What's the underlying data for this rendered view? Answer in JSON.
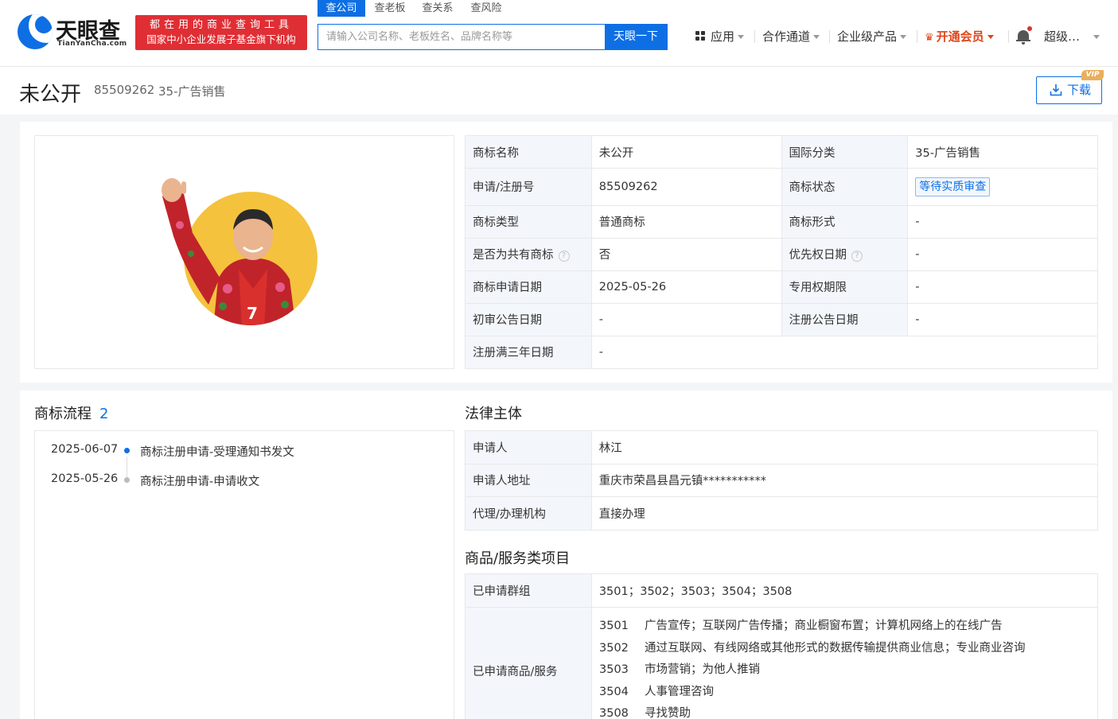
{
  "header": {
    "logo_text": "天眼查",
    "logo_sub": "TianYanCha.com",
    "badge_line1": "都在用的商业查询工具",
    "badge_line2": "国家中小企业发展子基金旗下机构",
    "search_tabs": [
      "查公司",
      "查老板",
      "查关系",
      "查风险"
    ],
    "search_placeholder": "请输入公司名称、老板姓名、品牌名称等",
    "search_button": "天眼一下",
    "nav": {
      "apps": "应用",
      "cooperation": "合作通道",
      "enterprise": "企业级产品",
      "vip": "开通会员",
      "user": "超级…"
    }
  },
  "title": {
    "name": "未公开",
    "reg_no": "85509262",
    "class": "35-广告销售",
    "download": "下载",
    "vip_tag": "VIP"
  },
  "info": {
    "rows": [
      {
        "k1": "商标名称",
        "v1": "未公开",
        "k2": "国际分类",
        "v2": "35-广告销售"
      },
      {
        "k1": "申请/注册号",
        "v1": "85509262",
        "k2": "商标状态",
        "v2": "等待实质审查"
      },
      {
        "k1": "商标类型",
        "v1": "普通商标",
        "k2": "商标形式",
        "v2": "-"
      },
      {
        "k1": "是否为共有商标",
        "v1": "否",
        "k2": "优先权日期",
        "v2": "-"
      },
      {
        "k1": "商标申请日期",
        "v1": "2025-05-26",
        "k2": "专用权期限",
        "v2": "-"
      },
      {
        "k1": "初审公告日期",
        "v1": "-",
        "k2": "注册公告日期",
        "v2": "-"
      },
      {
        "k1": "注册满三年日期",
        "v1": "-"
      }
    ]
  },
  "flow": {
    "title": "商标流程",
    "count": "2",
    "items": [
      {
        "date": "2025-06-07",
        "text": "商标注册申请-受理通知书发文",
        "color": "#0e6fe4"
      },
      {
        "date": "2025-05-26",
        "text": "商标注册申请-申请收文",
        "color": "#bbbbbb"
      }
    ]
  },
  "legal": {
    "title": "法律主体",
    "rows": [
      {
        "k": "申请人",
        "v": "林江"
      },
      {
        "k": "申请人地址",
        "v": "重庆市荣昌县昌元镇***********"
      },
      {
        "k": "代理/办理机构",
        "v": "直接办理"
      }
    ]
  },
  "goods": {
    "title": "商品/服务类项目",
    "groups_label": "已申请群组",
    "groups_value": "3501；3502；3503；3504；3508",
    "services_label": "已申请商品/服务",
    "services": [
      {
        "code": "3501",
        "text": "广告宣传；互联网广告传播；商业橱窗布置；计算机网络上的在线广告"
      },
      {
        "code": "3502",
        "text": "通过互联网、有线网络或其他形式的数据传输提供商业信息；专业商业咨询"
      },
      {
        "code": "3503",
        "text": "市场营销；为他人推销"
      },
      {
        "code": "3504",
        "text": "人事管理咨询"
      },
      {
        "code": "3508",
        "text": "寻找赞助"
      }
    ]
  },
  "colors": {
    "brand": "#0e6fe4",
    "badge": "#e02e35",
    "vip": "#e0441a"
  }
}
